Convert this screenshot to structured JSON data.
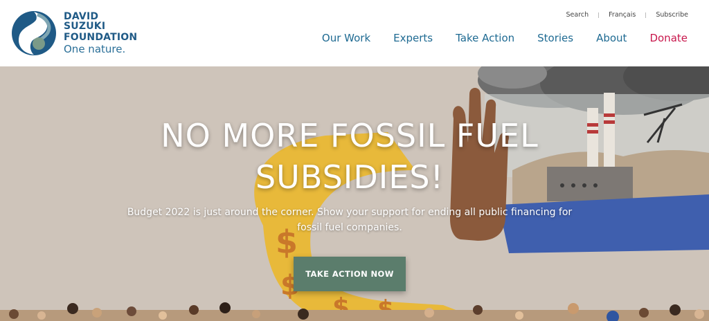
{
  "logo": {
    "line1": "DAVID SUZUKI",
    "line2": "FOUNDATION",
    "tagline": "One nature.",
    "icon": "david-suzuki-logo-mark"
  },
  "utility_nav": [
    {
      "label": "Search"
    },
    {
      "label": "Français"
    },
    {
      "label": "Subscribe"
    }
  ],
  "main_nav": [
    {
      "label": "Our Work"
    },
    {
      "label": "Experts"
    },
    {
      "label": "Take Action"
    },
    {
      "label": "Stories"
    },
    {
      "label": "About"
    },
    {
      "label": "Donate"
    }
  ],
  "hero": {
    "title_line1": "NO MORE FOSSIL FUEL",
    "title_line2": "SUBSIDIES!",
    "subtitle": "Budget 2022 is just around the corner. Show your support for ending all public financing for fossil fuel companies.",
    "cta_label": "TAKE ACTION NOW"
  },
  "colors": {
    "brand_blue": "#1e6a92",
    "donate_red": "#c8174c",
    "cta_green": "#5b7d6c",
    "hero_bg": "#cec4ba"
  }
}
